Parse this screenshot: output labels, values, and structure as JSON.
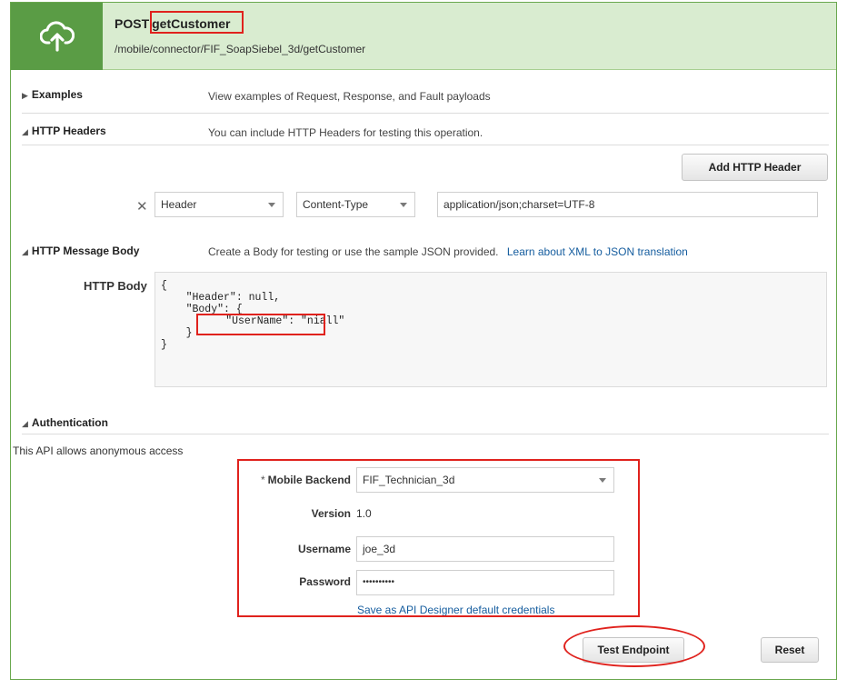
{
  "endpoint": {
    "method": "POST",
    "operation": "getCustomer",
    "path": "/mobile/connector/FIF_SoapSiebel_3d/getCustomer"
  },
  "icons": {
    "endpoint_icon": "cloud-upload-icon",
    "expand_icon": "triangle-right-icon",
    "collapse_icon": "triangle-down-icon",
    "remove_icon": "close-icon",
    "dropdown_icon": "chevron-down-icon"
  },
  "sections": {
    "examples": {
      "title": "Examples",
      "desc": "View examples of Request, Response, and Fault payloads",
      "expanded": false
    },
    "headers": {
      "title": "HTTP Headers",
      "desc": "You can include HTTP Headers for testing this operation.",
      "expanded": true
    },
    "body": {
      "title": "HTTP Message Body",
      "desc": "Create a Body for testing or use the sample JSON provided.",
      "link": "Learn about XML to JSON translation",
      "expanded": true
    },
    "auth": {
      "title": "Authentication",
      "expanded": true
    }
  },
  "headers": {
    "add_button": "Add HTTP Header",
    "rows": [
      {
        "type": "Header",
        "name": "Content-Type",
        "value": "application/json;charset=UTF-8"
      }
    ]
  },
  "body": {
    "label": "HTTP Body",
    "lines": [
      "{",
      "    \"Header\": null,",
      "    \"Body\": {",
      "        \"UserName\": \"niall\"",
      "    }",
      "}"
    ]
  },
  "auth": {
    "note": "This API allows anonymous access",
    "required_mark": "*",
    "backend_label": "Mobile Backend",
    "backend_value": "FIF_Technician_3d",
    "version_label": "Version",
    "version_value": "1.0",
    "username_label": "Username",
    "username_value": "joe_3d",
    "password_label": "Password",
    "password_value": "••••••••••",
    "save_link": "Save as API Designer default credentials"
  },
  "actions": {
    "test_button": "Test Endpoint",
    "reset_button": "Reset"
  },
  "colors": {
    "accent_green": "#5a9c45",
    "header_bg": "#d9ecd0",
    "link_blue": "#145c9e",
    "callout_red": "#e0221d"
  }
}
